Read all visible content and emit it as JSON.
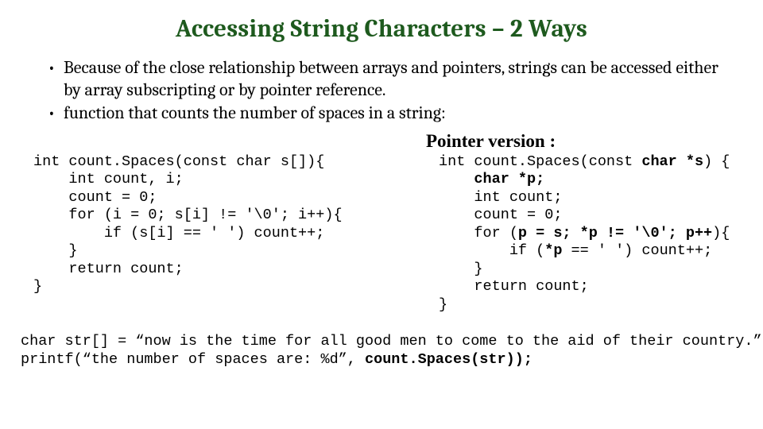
{
  "title": "Accessing String Characters – 2 Ways",
  "bullets": [
    "Because of the close relationship between arrays and pointers, strings can be accessed either by array subscripting or by pointer reference.",
    "function that counts the number of spaces in a string:"
  ],
  "pointer_heading": "Pointer version :",
  "code_left": {
    "l1": "int count.Spaces(const char s[]){",
    "l2": "    int count, i;",
    "l3": "    count = 0;",
    "l4": "    for (i = 0; s[i] != '\\0'; i++){",
    "l5": "        if (s[i] == ' ') count++;",
    "l6": "    }",
    "l7": "    return count;",
    "l8": "}"
  },
  "code_right": {
    "l1a": "int count.Spaces(const ",
    "l1b": "char *s",
    "l1c": ") {",
    "l2a": "    ",
    "l2b": "char *p;",
    "l3": "    int count;",
    "l4": "    count = 0;",
    "l5a": "    for (",
    "l5b": "p = s; *p != '\\0'; p++",
    "l5c": "){",
    "l6a": "        if (",
    "l6b": "*p",
    "l6c": " == ' ') count++;",
    "l7": "    }",
    "l8": "    return count;",
    "l9": "}"
  },
  "bottom": {
    "l1": "char str[] = “now is the time for all good men to come to the aid of their country.”;",
    "l2a": "printf(“the number of spaces are: %d”, ",
    "l2b": "count.Spaces(str));"
  }
}
